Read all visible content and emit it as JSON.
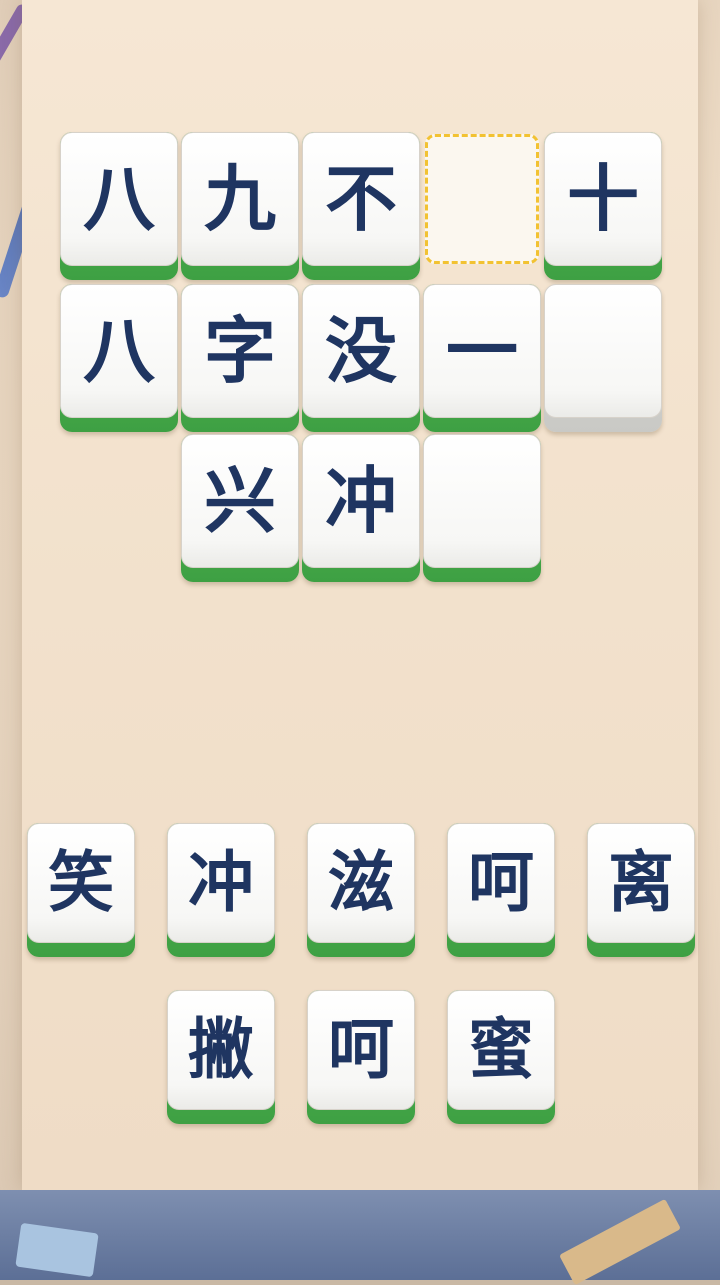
{
  "board": {
    "rows": [
      [
        "八",
        "九",
        "不",
        "",
        "十"
      ],
      [
        "八",
        "字",
        "没",
        "一",
        ""
      ],
      [
        "",
        "兴",
        "冲",
        "",
        ""
      ]
    ],
    "selected_slot": "row1-col4"
  },
  "choices": {
    "row1": [
      "笑",
      "冲",
      "滋",
      "呵",
      "离"
    ],
    "row2": [
      "撇",
      "呵",
      "蜜"
    ]
  },
  "colors": {
    "tile_text": "#1f3561",
    "tile_base": "#3ea043",
    "selected_slot_border": "#f2c232",
    "background": "#f2e1cc"
  }
}
